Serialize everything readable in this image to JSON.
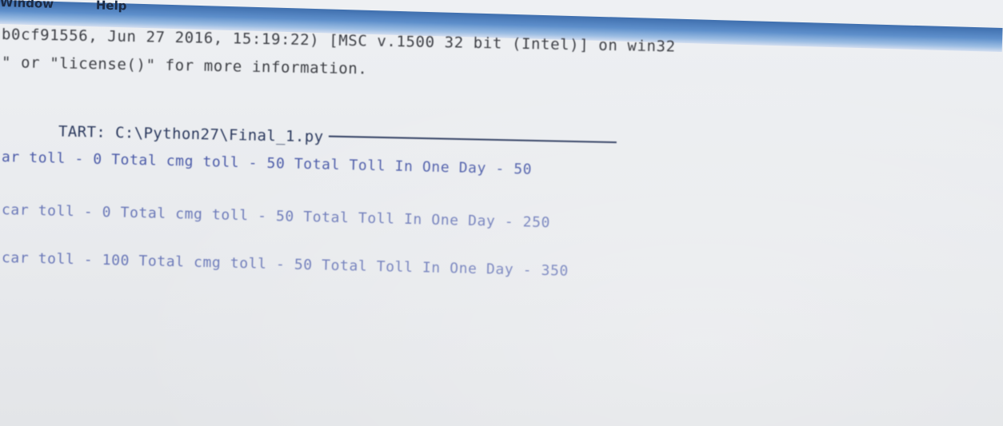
{
  "menu": {
    "items": [
      "Window",
      "Help"
    ]
  },
  "shell": {
    "banner_line_1": "b0cf91556, Jun 27 2016, 15:19:22) [MSC v.1500 32 bit (Intel)] on win32",
    "banner_line_2": "\" or \"license()\" for more information.",
    "restart_line": "TART: C:\\Python27\\Final_1.py",
    "output_lines": [
      "ar toll - 0 Total cmg toll - 50 Total Toll In One Day - 50",
      "car toll - 0 Total cmg toll - 50 Total Toll In One Day - 250",
      "car toll - 100 Total cmg toll - 50 Total Toll In One Day - 350"
    ]
  },
  "colors": {
    "titlebar": "#5e8fcb",
    "background": "#e9ebee",
    "banner_text": "#3d3f45",
    "output_text": "#4a5aa8"
  }
}
